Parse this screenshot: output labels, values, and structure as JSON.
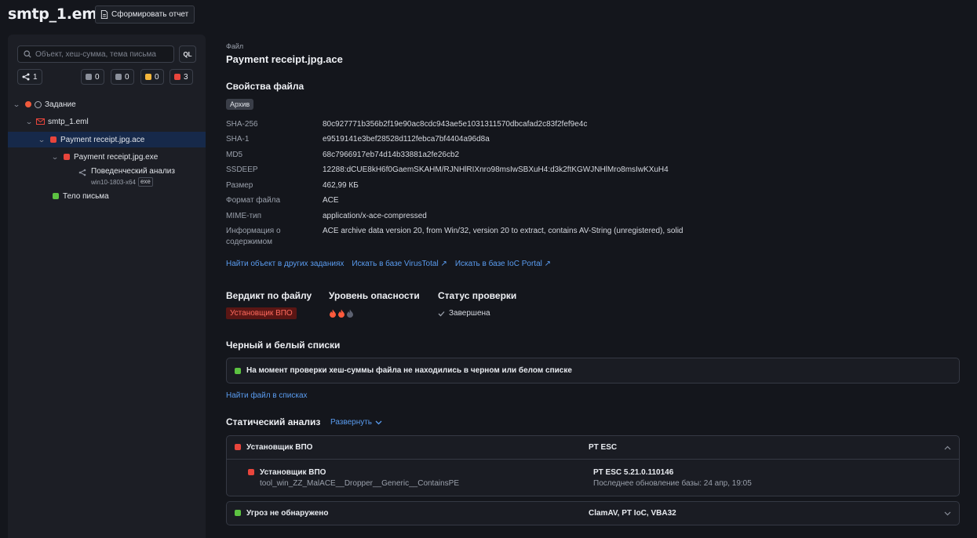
{
  "app": {
    "title": "smtp_1.eml",
    "report_button": "Сформировать отчет"
  },
  "sidebar": {
    "search_placeholder": "Объект, хеш-сумма, тема письма",
    "ql_button": "QL",
    "chips": [
      {
        "icon": "share-nodes-icon",
        "count": "1"
      },
      {
        "icon": "gray-square-icon",
        "count": "0",
        "color": "#8a8f9a"
      },
      {
        "icon": "gray-wrench-square-icon",
        "count": "0",
        "color": "#8a8f9a"
      },
      {
        "icon": "yellow-square-icon",
        "count": "0",
        "color": "#f4b63b"
      },
      {
        "icon": "red-square-icon",
        "count": "3",
        "color": "#e8453c"
      }
    ],
    "tree": {
      "task": "Задание",
      "email": "smtp_1.eml",
      "archive": "Payment receipt.jpg.ace",
      "exe": "Payment receipt.jpg.exe",
      "behavior": "Поведенческий анализ",
      "behavior_env": "win10-1803-x64",
      "behavior_tag": "exe",
      "body": "Тело письма"
    }
  },
  "file": {
    "caption": "Файл",
    "name": "Payment receipt.jpg.ace",
    "props_title": "Свойства файла",
    "type_tag": "Архив",
    "props": [
      {
        "key": "SHA-256",
        "value": "80c927771b356b2f19e90ac8cdc943ae5e1031311570dbcafad2c83f2fef9e4c"
      },
      {
        "key": "SHA-1",
        "value": "e9519141e3bef28528d112febca7bf4404a96d8a"
      },
      {
        "key": "MD5",
        "value": "68c7966917eb74d14b33881a2fe26cb2"
      },
      {
        "key": "SSDEEP",
        "value": "12288:dCUE8kH6f0GaemSKAHM/RJNHlRIXnro98msIwSBXuH4:d3k2ftKGWJNHlMro8msIwKXuH4"
      },
      {
        "key": "Размер",
        "value": "462,99 КБ"
      },
      {
        "key": "Формат файла",
        "value": "ACE"
      },
      {
        "key": "MIME-тип",
        "value": "application/x-ace-compressed"
      },
      {
        "key": "Информация о содержимом",
        "value": "ACE archive data version 20, from Win/32, version 20 to extract, contains AV-String (unregistered), solid"
      }
    ],
    "links": {
      "find_other": "Найти объект в других заданиях",
      "virustotal": "Искать в базе VirusTotal",
      "ioc_portal": "Искать в базе IoC Portal"
    }
  },
  "verdict": {
    "verdict_title": "Вердикт по файлу",
    "verdict_value": "Установщик ВПО",
    "danger_title": "Уровень опасности",
    "danger_level": "2 of 3",
    "status_title": "Статус проверки",
    "status_value": "Завершена"
  },
  "lists": {
    "title": "Черный и белый списки",
    "message": "На момент проверки хеш-суммы файла не находились в черном или белом списке",
    "find_link": "Найти файл в списках"
  },
  "static": {
    "title": "Статический анализ",
    "expand": "Развернуть",
    "group1": {
      "verdict": "Установщик ВПО",
      "engine": "PT ESC",
      "detail_verdict": "Установщик ВПО",
      "detail_rule": "tool_win_ZZ_MalACE__Dropper__Generic__ContainsPE",
      "detail_engine": "PT ESC 5.21.0.110146",
      "detail_update": "Последнее обновление базы: 24 апр, 19:05"
    },
    "group2": {
      "verdict": "Угроз не обнаружено",
      "engines": "ClamAV, PT IoC, VBA32"
    }
  },
  "colors": {
    "accent": "#5a9cf0",
    "red": "#e8453c",
    "green": "#5cc241",
    "yellow": "#f4b63b",
    "selection": "#16294a"
  }
}
